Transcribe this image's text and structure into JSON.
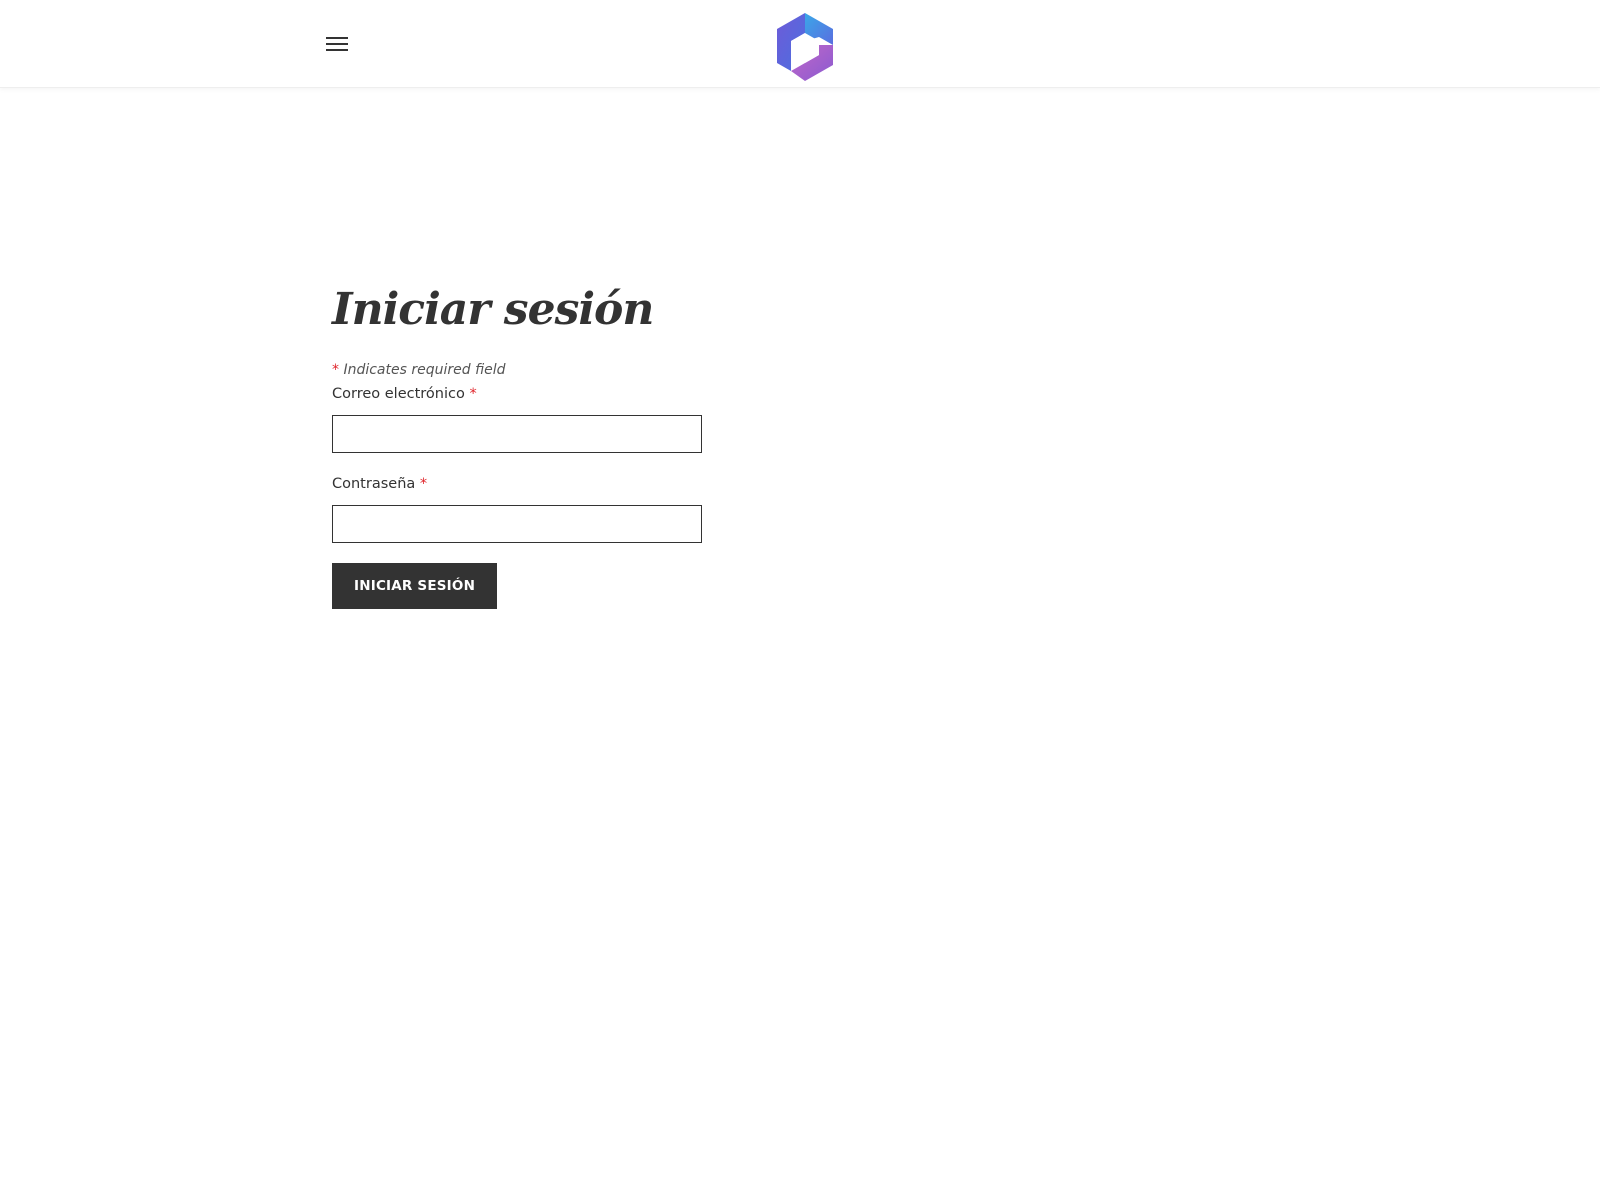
{
  "header": {
    "menu_icon": "hamburger-menu-icon",
    "logo_icon": "microsoft-365-logo-icon",
    "logo_colors": [
      "#6e5bd8",
      "#3aa7e8",
      "#8a5ad0",
      "#c168c9"
    ]
  },
  "form": {
    "title": "Iniciar sesión",
    "required_note_asterisk": "*",
    "required_note": "Indicates required field",
    "email_label": "Correo electrónico",
    "email_asterisk": "*",
    "email_value": "",
    "password_label": "Contraseña",
    "password_asterisk": "*",
    "password_value": "",
    "submit_label": "INICIAR SESIÓN"
  },
  "colors": {
    "text": "#333333",
    "required": "#e0252b",
    "button_bg": "#333333",
    "button_text": "#ffffff"
  }
}
